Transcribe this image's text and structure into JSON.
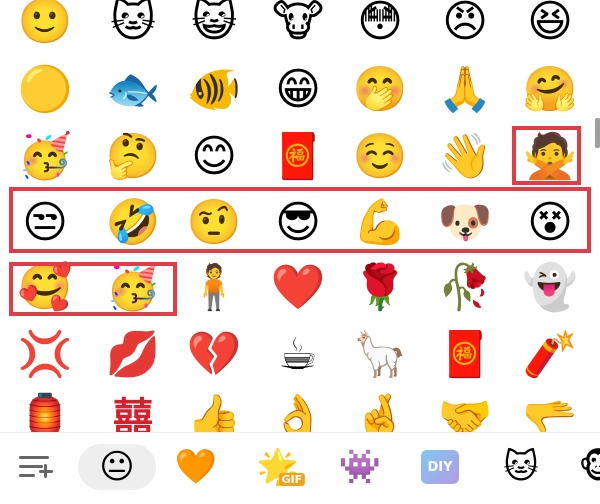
{
  "emoji_grid": {
    "rows": [
      [
        "🙂",
        "🐱",
        "😺",
        "🐮",
        "😳",
        "😠",
        "😆"
      ],
      [
        "🟡",
        "🐟",
        "🐠",
        "😁",
        "🤭",
        "🙏",
        "🤗"
      ],
      [
        "🥳",
        "🤔",
        "😊",
        "🧧",
        "☺️",
        "👋",
        "🙅"
      ],
      [
        "😒",
        "🤣",
        "🤨",
        "😎",
        "💪",
        "🐶",
        "😵"
      ],
      [
        "🥰",
        "🥳",
        "🧍",
        "❤️",
        "🌹",
        "🥀",
        "👻"
      ],
      [
        "💢",
        "💋",
        "💔",
        "☕",
        "🦙",
        "🧧",
        "🧨"
      ],
      [
        "🏮",
        "囍",
        "👍",
        "👌",
        "🤞",
        "🤝",
        "🫳"
      ]
    ]
  },
  "bottom_tabs": [
    {
      "name": "manage",
      "icon": "list-add-icon"
    },
    {
      "name": "emoji",
      "icon": "emoji-icon",
      "glyph": "😐"
    },
    {
      "name": "favorites",
      "icon": "heart-icon",
      "glyph": "🧡"
    },
    {
      "name": "gif",
      "icon": "gif-icon",
      "glyph": "🌟",
      "badge": "GIF"
    },
    {
      "name": "sticker",
      "icon": "ghost-sticker-icon",
      "glyph": "👾"
    },
    {
      "name": "diy",
      "icon": "diy-icon",
      "badge": "DIY"
    },
    {
      "name": "cat-sticker",
      "icon": "cat-sticker-icon",
      "glyph": "🐱"
    },
    {
      "name": "more",
      "icon": "more-sticker-icon",
      "glyph": "🐵"
    }
  ],
  "highlight_color": "#e23c47"
}
